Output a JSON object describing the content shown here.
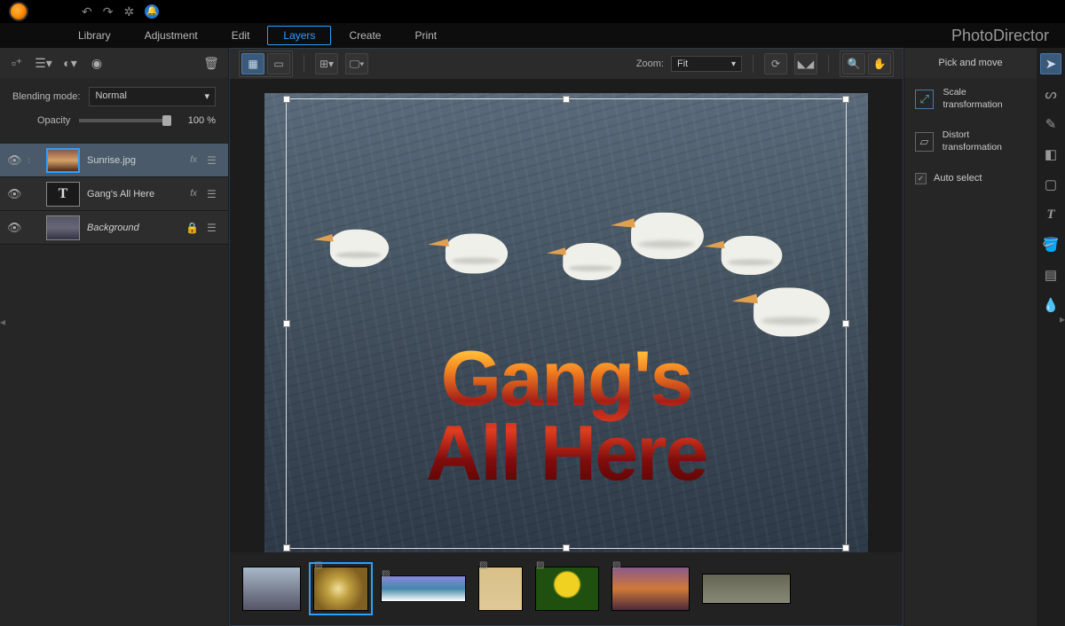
{
  "brand": "PhotoDirector",
  "menu": {
    "items": [
      "Library",
      "Adjustment",
      "Edit",
      "Layers",
      "Create",
      "Print"
    ],
    "activeIndex": 3
  },
  "layers_panel": {
    "blend_label": "Blending mode:",
    "blend_value": "Normal",
    "opacity_label": "Opacity",
    "opacity_value": "100 %",
    "items": [
      {
        "name": "Sunrise.jpg",
        "type": "image",
        "selected": true,
        "fx": "fx"
      },
      {
        "name": "Gang's All Here",
        "type": "text",
        "selected": false,
        "fx": "fx"
      },
      {
        "name": "Background",
        "type": "bg",
        "selected": false,
        "locked": true
      }
    ]
  },
  "canvas_toolbar": {
    "zoom_label": "Zoom:",
    "zoom_value": "Fit"
  },
  "canvas_text_line1": "Gang's",
  "canvas_text_line2": "All Here",
  "right_panel": {
    "title": "Pick and move",
    "scale": "Scale transformation",
    "distort": "Distort transformation",
    "auto_select": "Auto select"
  },
  "icons": {
    "search": "🔍",
    "gear": "⚙",
    "bell": "🔔",
    "undo": "↶",
    "redo": "↷"
  }
}
